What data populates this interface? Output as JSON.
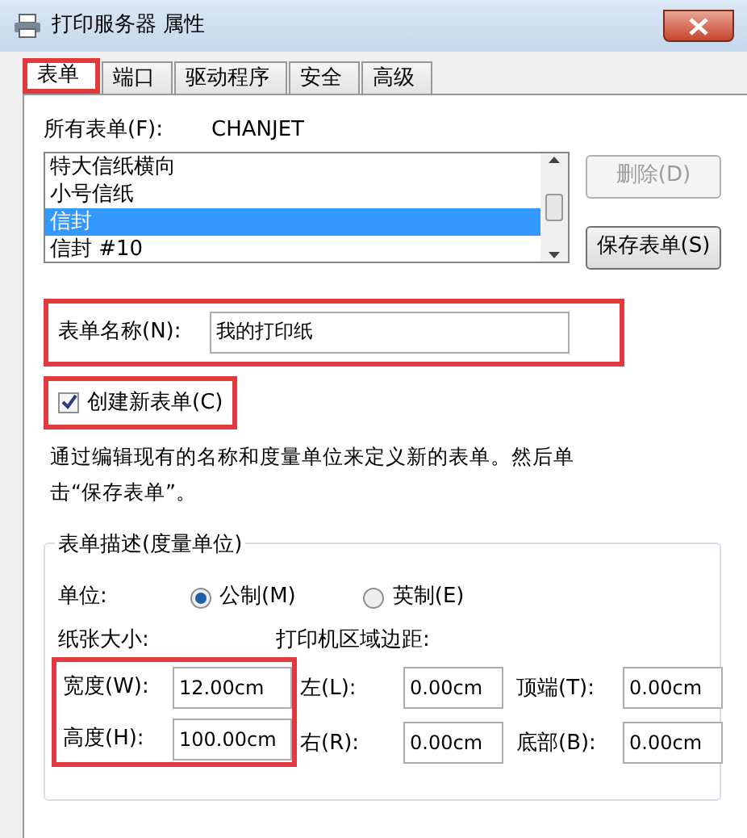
{
  "window": {
    "title": "打印服务器 属性"
  },
  "tabs": [
    {
      "label": "表单",
      "selected": true,
      "highlighted": true
    },
    {
      "label": "端口",
      "selected": false,
      "highlighted": false
    },
    {
      "label": "驱动程序",
      "selected": false,
      "highlighted": false
    },
    {
      "label": "安全",
      "selected": false,
      "highlighted": false
    },
    {
      "label": "高级",
      "selected": false,
      "highlighted": false
    }
  ],
  "forms_label": "所有表单(F):",
  "server_name": "CHANJET",
  "form_list": [
    {
      "label": "特大信纸横向",
      "selected": false
    },
    {
      "label": "小号信纸",
      "selected": false
    },
    {
      "label": "信封",
      "selected": true
    },
    {
      "label": "信封 #10",
      "selected": false
    }
  ],
  "buttons": [
    {
      "label": "删除(D)",
      "disabled": true
    },
    {
      "label": "保存表单(S)",
      "disabled": false
    }
  ],
  "form_name": {
    "label": "表单名称(N):",
    "value": "我的打印纸",
    "highlighted": true
  },
  "create_new": {
    "label": "创建新表单(C)",
    "checked": true,
    "highlighted": true
  },
  "description": "通过编辑现有的名称和度量单位来定义新的表单。然后单击“保存表单”。",
  "group": {
    "title": "表单描述(度量单位)",
    "units_label": "单位:",
    "units": [
      {
        "label": "公制(M)",
        "selected": true
      },
      {
        "label": "英制(E)",
        "selected": false
      }
    ],
    "paper_size_label": "纸张大小:",
    "margins_label": "打印机区域边距:",
    "paper_size": {
      "highlighted": true,
      "fields": [
        {
          "label": "宽度(W):",
          "value": "12.00cm"
        },
        {
          "label": "高度(H):",
          "value": "100.00cm"
        }
      ]
    },
    "margins": [
      {
        "label": "左(L):",
        "value": "0.00cm"
      },
      {
        "label": "顶端(T):",
        "value": "0.00cm"
      },
      {
        "label": "右(R):",
        "value": "0.00cm"
      },
      {
        "label": "底部(B):",
        "value": "0.00cm"
      }
    ]
  }
}
